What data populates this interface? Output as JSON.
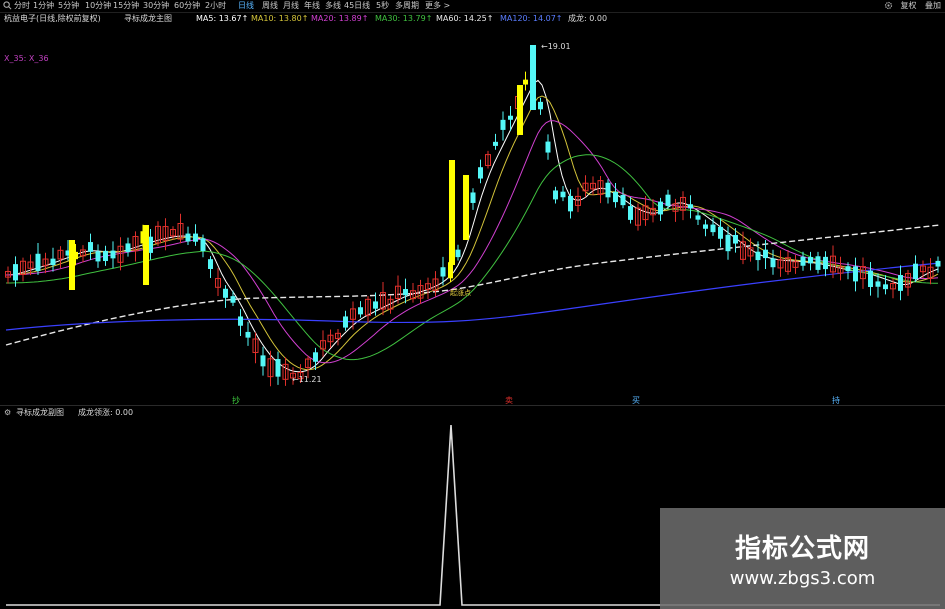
{
  "toolbar": {
    "tabs": [
      "分时",
      "1分钟",
      "5分钟",
      "10分钟",
      "15分钟",
      "30分钟",
      "60分钟",
      "2小时",
      "日线",
      "周线",
      "月线",
      "年线",
      "多线",
      "45日线",
      "5秒",
      "多周期",
      "更多 >"
    ],
    "active_tab": "日线",
    "right_buttons": [
      "复权",
      "叠加"
    ]
  },
  "main_header": {
    "stock": "杭益电子(日线,除权前复权)",
    "indicator": "寻标成龙主图",
    "ma5_label": "MA5: 13.67↑",
    "ma10_label": "MA10: 13.80↑",
    "ma20_label": "MA20: 13.89↑",
    "ma30_label": "MA30: 13.79↑",
    "ma60_label": "MA60: 14.25↑",
    "ma120_label": "MA120: 14.07↑",
    "extra_label": "成龙: 0.00"
  },
  "x_label": "X_35: X_36",
  "annotations": {
    "high": "19.01",
    "low": "11.21",
    "mid_label": "起涨点",
    "marks": [
      "抄",
      "卖",
      "买",
      "持"
    ]
  },
  "sub_header": {
    "indicator": "寻标成龙副图",
    "value_label": "成龙领涨: 0.00"
  },
  "watermark": {
    "title": "指标公式网",
    "url": "www.zbgs3.com"
  },
  "colors": {
    "up": "#e0302c",
    "down": "#54f7f7",
    "signal": "#ffff00",
    "ma5": "#ffffff",
    "ma10": "#d4c43a",
    "ma20": "#d040d0",
    "ma30": "#40c040",
    "ma60": "#e8e8e8",
    "ma120": "#3a40ff",
    "active": "#59b6ff"
  }
}
